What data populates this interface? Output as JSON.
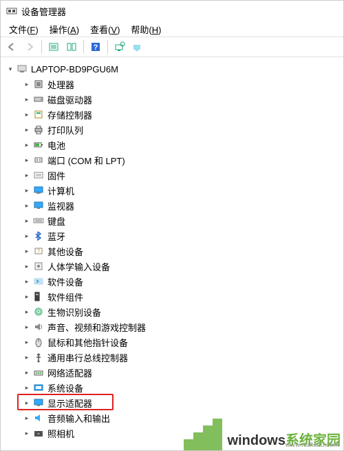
{
  "window": {
    "title": "设备管理器"
  },
  "menu": {
    "file": {
      "label": "文件",
      "accel": "F"
    },
    "action": {
      "label": "操作",
      "accel": "A"
    },
    "view": {
      "label": "查看",
      "accel": "V"
    },
    "help": {
      "label": "帮助",
      "accel": "H"
    }
  },
  "tree": {
    "root": {
      "label": "LAPTOP-BD9PGU6M"
    },
    "items": [
      {
        "label": "处理器",
        "icon": "cpu"
      },
      {
        "label": "磁盘驱动器",
        "icon": "disk"
      },
      {
        "label": "存储控制器",
        "icon": "storage"
      },
      {
        "label": "打印队列",
        "icon": "printer"
      },
      {
        "label": "电池",
        "icon": "battery"
      },
      {
        "label": "端口 (COM 和 LPT)",
        "icon": "port"
      },
      {
        "label": "固件",
        "icon": "firmware"
      },
      {
        "label": "计算机",
        "icon": "computer"
      },
      {
        "label": "监视器",
        "icon": "monitor"
      },
      {
        "label": "键盘",
        "icon": "keyboard"
      },
      {
        "label": "蓝牙",
        "icon": "bluetooth"
      },
      {
        "label": "其他设备",
        "icon": "other"
      },
      {
        "label": "人体学输入设备",
        "icon": "hid"
      },
      {
        "label": "软件设备",
        "icon": "software"
      },
      {
        "label": "软件组件",
        "icon": "component"
      },
      {
        "label": "生物识别设备",
        "icon": "biometric"
      },
      {
        "label": "声音、视频和游戏控制器",
        "icon": "sound"
      },
      {
        "label": "鼠标和其他指针设备",
        "icon": "mouse"
      },
      {
        "label": "通用串行总线控制器",
        "icon": "usb"
      },
      {
        "label": "网络适配器",
        "icon": "network"
      },
      {
        "label": "系统设备",
        "icon": "system"
      },
      {
        "label": "显示适配器",
        "icon": "display",
        "highlighted": true
      },
      {
        "label": "音频输入和输出",
        "icon": "audio"
      },
      {
        "label": "照相机",
        "icon": "camera"
      }
    ]
  },
  "watermark": {
    "brand_left": "windows",
    "brand_right": "系统家园",
    "url": "www.ruihaifu.com"
  }
}
